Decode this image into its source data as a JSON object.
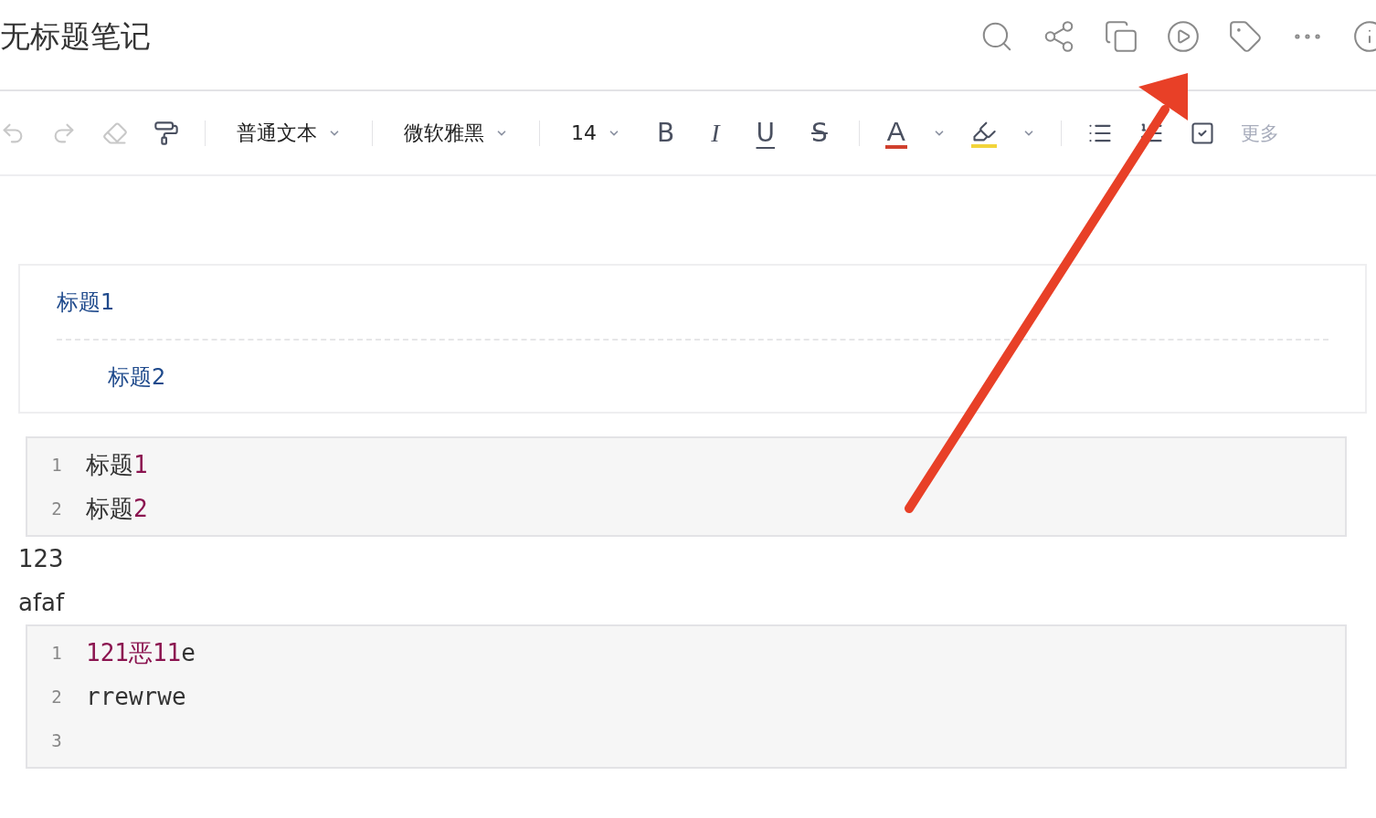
{
  "title": "无标题笔记",
  "toolbar": {
    "paragraph_style": "普通文本",
    "font": "微软雅黑",
    "font_size": "14",
    "format_buttons": [
      {
        "label": "B",
        "kind": "bold"
      },
      {
        "label": "I",
        "kind": "italic"
      },
      {
        "label": "U",
        "kind": "underline"
      },
      {
        "label": "S",
        "kind": "strike"
      }
    ],
    "font_color": "A",
    "more": "更多"
  },
  "body": [
    {
      "kind": "toc",
      "items": [
        {
          "text": "标题1",
          "children": [
            {
              "text": "标题2"
            }
          ]
        }
      ]
    },
    {
      "kind": "code",
      "lines": [
        {
          "number": "1",
          "tokens": [
            {
              "text": "标题",
              "kind": "plain"
            },
            {
              "text": "1",
              "kind": "number"
            }
          ]
        },
        {
          "number": "2",
          "tokens": [
            {
              "text": "标题",
              "kind": "plain"
            },
            {
              "text": "2",
              "kind": "number"
            }
          ]
        }
      ]
    },
    {
      "kind": "paragraph",
      "text": "123"
    },
    {
      "kind": "paragraph",
      "text": "afaf"
    },
    {
      "kind": "code",
      "lines": [
        {
          "number": "1",
          "tokens": [
            {
              "text": "121恶11",
              "kind": "number"
            },
            {
              "text": "e",
              "kind": "plain"
            }
          ]
        },
        {
          "number": "2",
          "tokens": [
            {
              "text": "rrewrwe",
              "kind": "plain"
            }
          ]
        },
        {
          "number": "3"
        }
      ]
    }
  ]
}
